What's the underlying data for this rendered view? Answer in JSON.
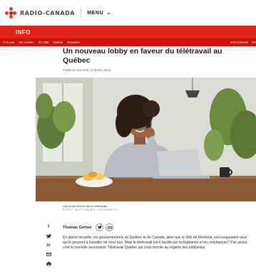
{
  "header": {
    "logo_text": "RADIO-CANADA",
    "menu_label": "MENU",
    "menu_icon": "chevron-down-icon",
    "brand_color": "#e2231a"
  },
  "section": {
    "title": "INFO"
  },
  "nav": {
    "items": [
      "À la une",
      "En continu",
      "ICI RDI",
      "Vidéos",
      "Dossiers"
    ],
    "right_items": [
      "International",
      "Po"
    ]
  },
  "article": {
    "headline": "Un nouveau lobby en faveur du télétravail au Québec",
    "pubdate": "Publié le mercredi 13 février 2019",
    "image_caption": "Une jeune femme fait du télétravail.",
    "image_credit": "PHOTO : GETTY IMAGES / ISTOCKPHOTO",
    "author": "Thomas Gerbet",
    "body": "En pleine tempête, les gouvernements du Québec et du Canada, ainsi que la Ville de Montréal, encourageaient ceux qui le peuvent à travailler de chez eux. Mais le télétravail est-il facilité par la législation et les employeurs? Pas assez, croit la nouvelle association Télétravail Québec qui s'est inscrite au registre des lobbyistes."
  },
  "share_icons": [
    "facebook-icon",
    "twitter-icon",
    "linkedin-icon",
    "email-icon",
    "print-icon"
  ],
  "author_icons": [
    "twitter-icon",
    "email-icon"
  ]
}
